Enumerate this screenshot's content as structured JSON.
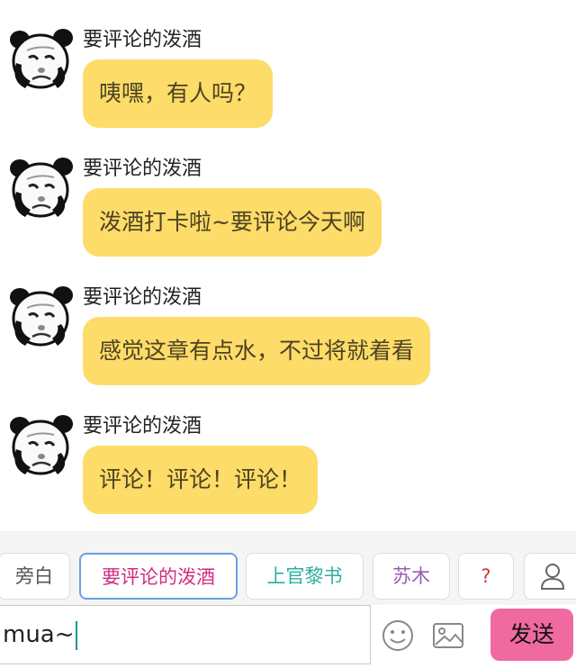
{
  "messages": [
    {
      "sender": "要评论的泼酒",
      "text": "咦嘿，有人吗？"
    },
    {
      "sender": "要评论的泼酒",
      "text": "泼酒打卡啦~要评论今天啊"
    },
    {
      "sender": "要评论的泼酒",
      "text": "感觉这章有点水，不过将就着看"
    },
    {
      "sender": "要评论的泼酒",
      "text": "评论！评论！评论！"
    }
  ],
  "role_bar": {
    "chips": [
      {
        "label": "旁白",
        "color": "#555555"
      },
      {
        "label": "要评论的泼酒",
        "color": "#d02c7f"
      },
      {
        "label": "上官黎书",
        "color": "#2bb0a2"
      },
      {
        "label": "苏木",
        "color": "#9a5db5"
      },
      {
        "label": "?",
        "color": "#d23a3a"
      }
    ],
    "add_role_icon": "person-icon"
  },
  "input_bar": {
    "value": "mua~",
    "emoji_icon": "smiley-icon",
    "image_icon": "image-icon",
    "send_label": "发送"
  },
  "colors": {
    "bubble": "#fddc6a",
    "send_button": "#f06aa0",
    "active_chip_border": "#6a9fe2"
  }
}
